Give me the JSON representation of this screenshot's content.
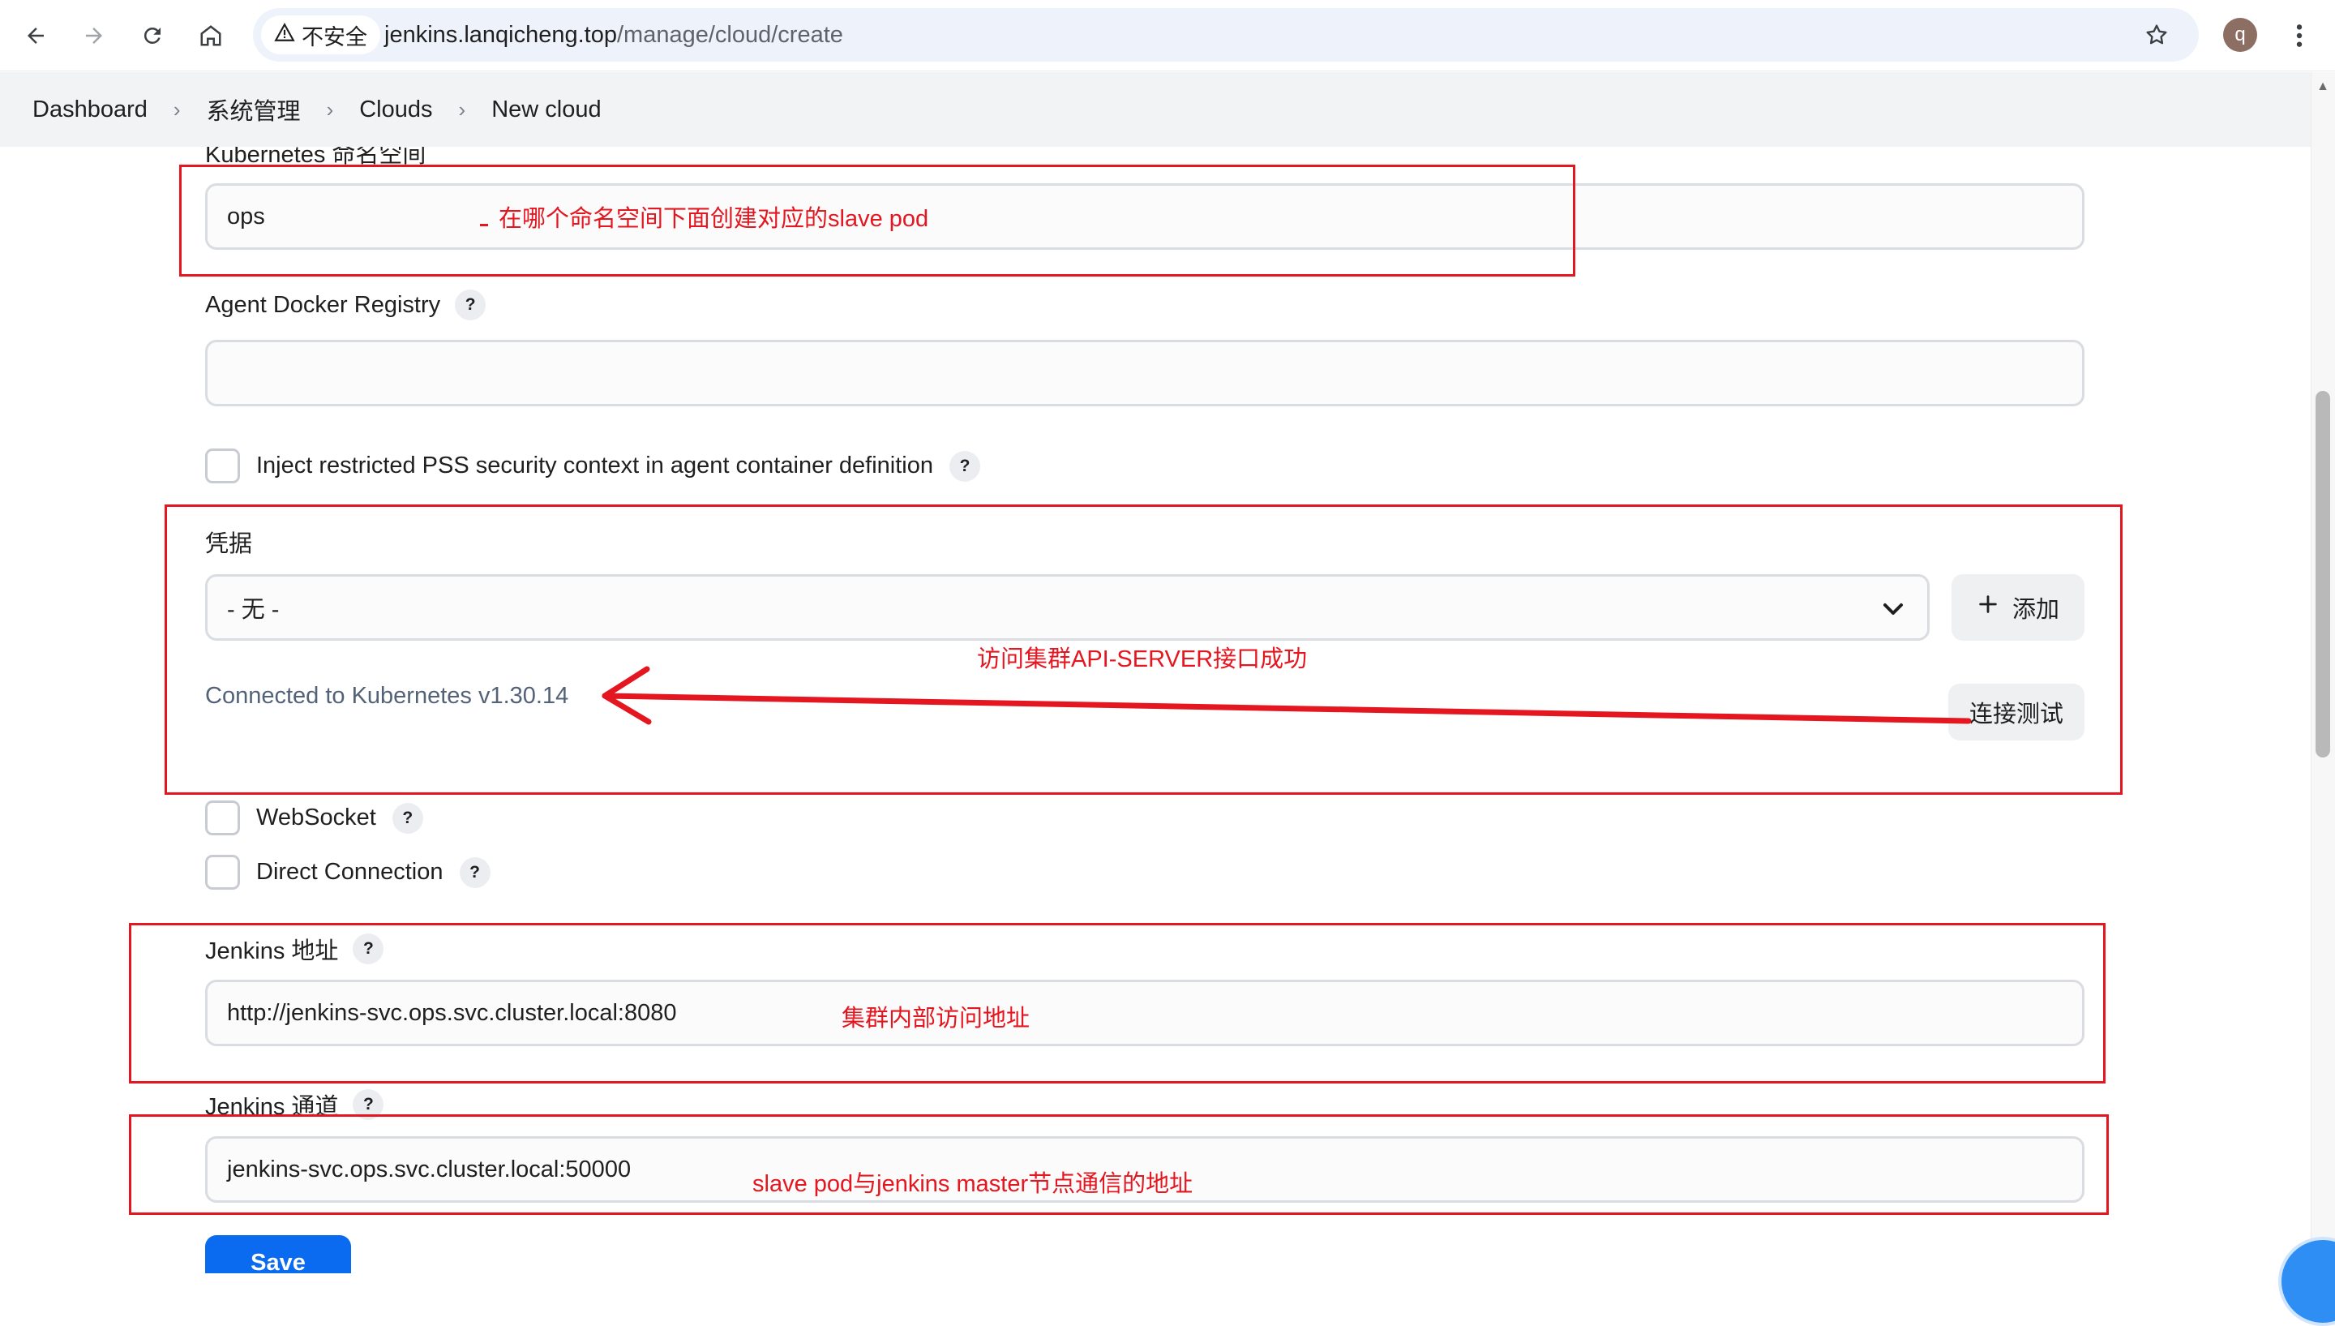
{
  "browser": {
    "security_label": "不安全",
    "url_host": "jenkins.lanqicheng.top",
    "url_path": "/manage/cloud/create",
    "profile_initial": "q",
    "icons": [
      "back-arrow-icon",
      "forward-arrow-icon",
      "reload-icon",
      "home-icon",
      "warning-triangle-icon",
      "star-icon",
      "kebab-menu-icon"
    ]
  },
  "breadcrumb": {
    "items": [
      "Dashboard",
      "系统管理",
      "Clouds",
      "New cloud"
    ]
  },
  "form": {
    "namespace": {
      "label": "Kubernetes 命名空间",
      "value": "ops"
    },
    "docker_registry": {
      "label": "Agent Docker Registry",
      "help": "?",
      "value": ""
    },
    "inject_pss": {
      "label": "Inject restricted PSS security context in agent container definition",
      "help": "?",
      "checked": false
    },
    "credentials": {
      "label": "凭据",
      "selected": "- 无 -",
      "add_button": "添加",
      "add_icon": "plus-icon"
    },
    "connection": {
      "status": "Connected to Kubernetes v1.30.14",
      "test_button": "连接测试"
    },
    "websocket": {
      "label": "WebSocket",
      "help": "?",
      "checked": false
    },
    "direct_connection": {
      "label": "Direct Connection",
      "help": "?",
      "checked": false
    },
    "jenkins_url": {
      "label": "Jenkins 地址",
      "help": "?",
      "value": "http://jenkins-svc.ops.svc.cluster.local:8080"
    },
    "jenkins_tunnel": {
      "label": "Jenkins 通道",
      "help": "?",
      "value": "jenkins-svc.ops.svc.cluster.local:50000"
    },
    "save_button": "Save"
  },
  "annotations": {
    "namespace_note": "在哪个命名空间下面创建对应的slave pod",
    "connection_note": "访问集群API-SERVER接口成功",
    "url_note": "集群内部访问地址",
    "tunnel_note": "slave pod与jenkins master节点通信的地址",
    "color": "#e4161f"
  }
}
